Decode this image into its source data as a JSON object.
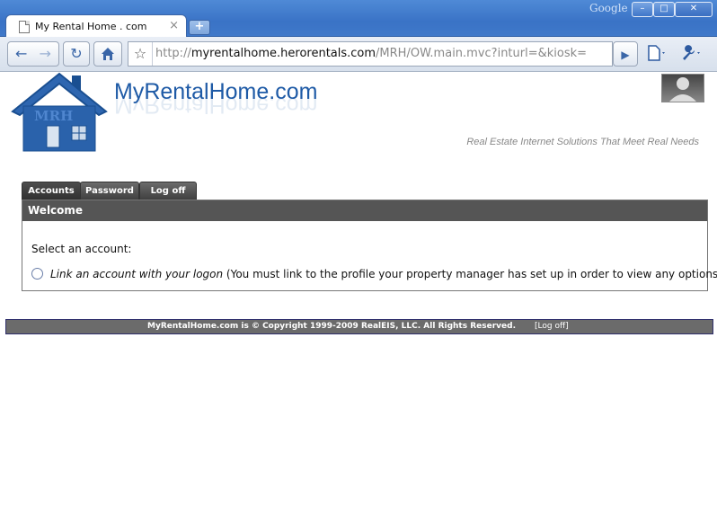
{
  "browser": {
    "tab_title": "My Rental Home . com",
    "tab_close": "×",
    "new_tab": "+",
    "brand": "Google",
    "window_controls": {
      "minimize": "–",
      "maximize": "□",
      "close": "✕"
    },
    "url_prefix": "http://",
    "url_host": "myrentalhome.herorentals.com",
    "url_path": "/MRH/OW.main.mvc?inturl=&kiosk=",
    "icons": {
      "back": "back-arrow-icon",
      "forward": "forward-arrow-icon",
      "reload": "reload-icon",
      "home": "home-icon",
      "bookmark": "star-icon",
      "go": "play-icon",
      "page_menu": "page-icon",
      "tools_menu": "wrench-icon"
    }
  },
  "site": {
    "title": "MyRentalHome.com",
    "logo_text": "MRH",
    "tagline": "Real Estate Internet Solutions That Meet Real Needs"
  },
  "nav": {
    "tabs": [
      {
        "label": "Accounts"
      },
      {
        "label": "Password"
      },
      {
        "label": "Log off"
      }
    ]
  },
  "panel": {
    "heading": "Welcome",
    "prompt": "Select an account:",
    "option_link": "Link an account with your logon",
    "option_note": " (You must link to the profile your property manager has set up in order to view any options)"
  },
  "footer": {
    "copyright": "MyRentalHome.com is © Copyright 1999-2009 RealEIS, LLC. All Rights Reserved.",
    "logoff_label": "Log off"
  },
  "colors": {
    "brand_blue": "#1e5aa6",
    "tab_dark": "#3d3d3d",
    "panel_head": "#555555",
    "footer_bg": "#6b6b6b"
  }
}
